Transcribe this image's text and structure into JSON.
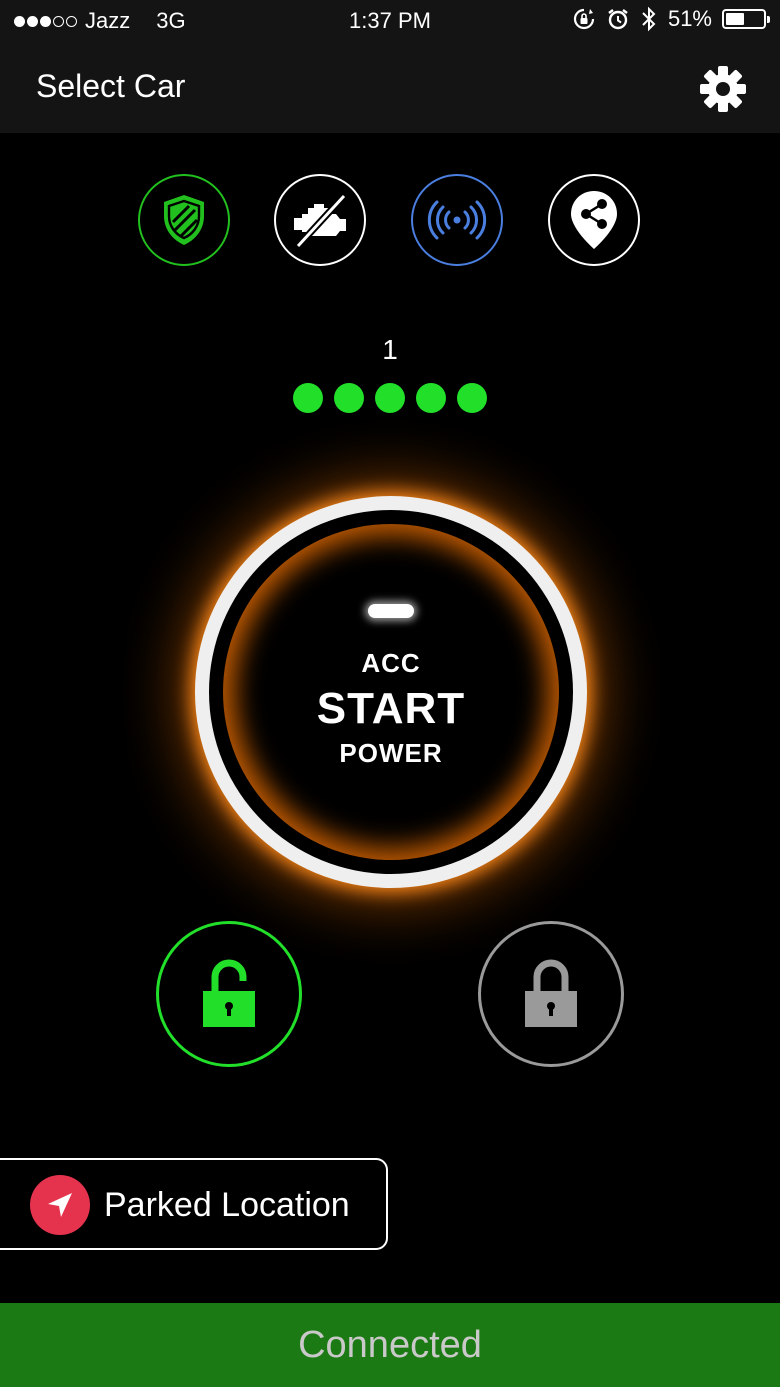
{
  "status_bar": {
    "carrier": "Jazz",
    "network": "3G",
    "time": "1:37 PM",
    "battery_percent_label": "51%",
    "battery_level": 0.51,
    "signal_bars_filled": 3,
    "signal_bars_total": 5
  },
  "nav": {
    "title": "Select Car",
    "settings_icon": "gear-icon"
  },
  "features": [
    {
      "icon": "shield-icon",
      "color": "#22c01e"
    },
    {
      "icon": "engine-off-icon",
      "color": "#ffffff"
    },
    {
      "icon": "signal-waves-icon",
      "color": "#4a7fe0"
    },
    {
      "icon": "share-location-icon",
      "color": "#ffffff"
    }
  ],
  "counter": "1",
  "level_dots": 5,
  "start_button": {
    "acc_label": "ACC",
    "main_label": "START",
    "power_label": "POWER",
    "ring_color": "#ff8a1a"
  },
  "locks": {
    "unlock": {
      "icon": "unlock-icon",
      "color": "#22e02a"
    },
    "lock": {
      "icon": "lock-icon",
      "color": "#9a9a9a"
    }
  },
  "parked_location": {
    "label": "Parked Location",
    "icon": "navigation-arrow-icon",
    "icon_bg": "#e5324d"
  },
  "connection": {
    "label": "Connected",
    "bg": "#1c7a14"
  }
}
